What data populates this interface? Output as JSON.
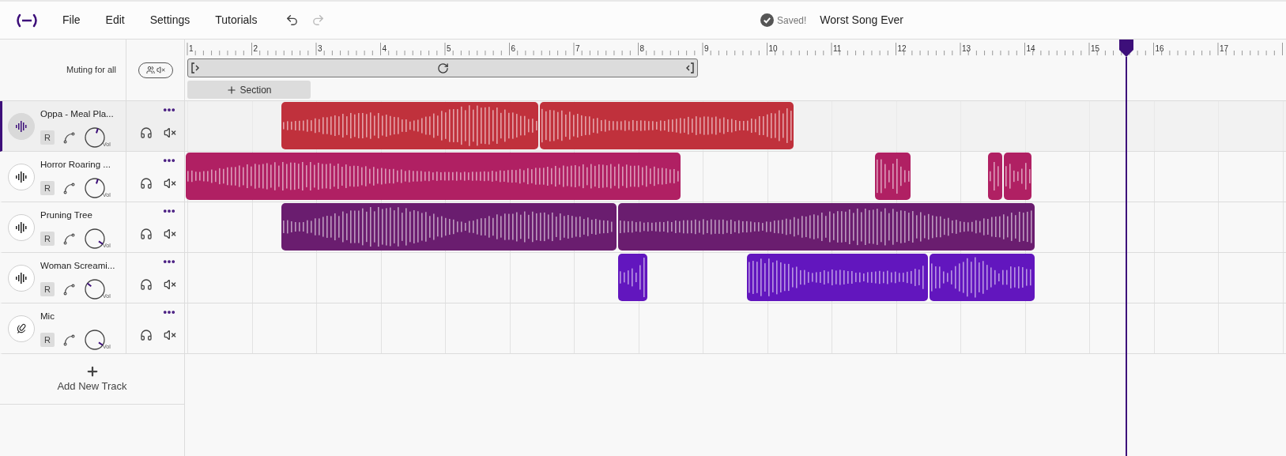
{
  "menu": [
    {
      "label": "File"
    },
    {
      "label": "Edit"
    },
    {
      "label": "Settings"
    },
    {
      "label": "Tutorials"
    }
  ],
  "history": {
    "undo_disabled": false,
    "redo_disabled": true
  },
  "status": "Saved!",
  "song_title": "Worst Song Ever",
  "muting_label": "Muting for all",
  "ruler": [
    "1",
    "2",
    "3",
    "4",
    "5",
    "6",
    "7",
    "8",
    "9",
    "10",
    "11",
    "12",
    "13",
    "14",
    "15",
    "16",
    "17"
  ],
  "section_button": "Section",
  "tracks": [
    {
      "name": "Oppa - Meal Pla...",
      "kind": "audio",
      "selected": true,
      "record_label": "R",
      "volume_label": "Vol",
      "level": 0.57,
      "color": "#c0313c"
    },
    {
      "name": "Horror Roaring ...",
      "kind": "audio",
      "selected": false,
      "record_label": "R",
      "volume_label": "Vol",
      "level": 0.57,
      "color": "#b02063"
    },
    {
      "name": "Pruning Tree",
      "kind": "audio",
      "selected": false,
      "record_label": "R",
      "volume_label": "Vol",
      "level": 0.96,
      "color": "#6a1d6f"
    },
    {
      "name": "Woman Screami...",
      "kind": "audio",
      "selected": false,
      "record_label": "R",
      "volume_label": "Vol",
      "level": 0.31,
      "color": "#6216be"
    },
    {
      "name": "Mic",
      "kind": "mic",
      "selected": false,
      "record_label": "R",
      "volume_label": "Vol",
      "level": 0.96
    }
  ],
  "add_track": "Add New Track"
}
